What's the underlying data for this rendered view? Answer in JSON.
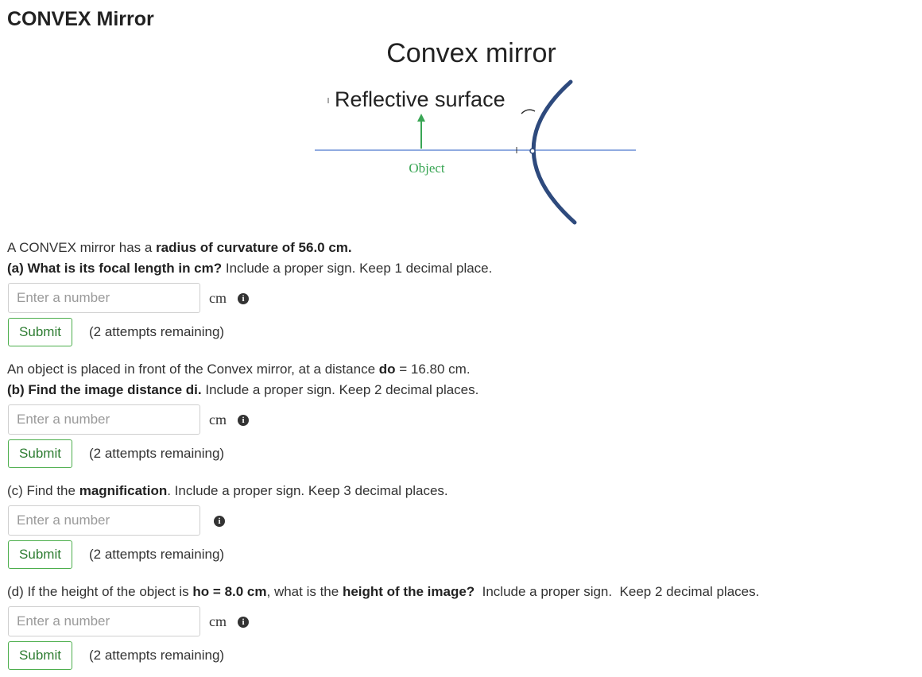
{
  "page_title": "CONVEX Mirror",
  "figure": {
    "title": "Convex mirror",
    "surface_label": "Reflective surface",
    "object_label": "Object",
    "colors": {
      "axis": "#6b8fd6",
      "mirror": "#2e4a7d",
      "object": "#3aa655"
    }
  },
  "intro": {
    "prefix": "A CONVEX mirror has a ",
    "bold": "radius of curvature of 56.0 cm."
  },
  "parts": {
    "a": {
      "bold": "(a) What is its focal length in cm?",
      "text": " Include a proper sign. Keep 1 decimal place.",
      "placeholder": "Enter a number",
      "unit": "cm",
      "submit": "Submit",
      "attempts": "(2 attempts remaining)"
    },
    "b": {
      "context_prefix": "An object is placed in front of the Convex mirror, at a distance ",
      "context_bold": "do",
      "context_suffix": " = 16.80 cm.",
      "bold": "(b) Find the image distance di.",
      "text": " Include a proper sign. Keep 2 decimal places.",
      "placeholder": "Enter a number",
      "unit": "cm",
      "submit": "Submit",
      "attempts": "(2 attempts remaining)"
    },
    "c": {
      "prefix": "(c) Find the ",
      "bold": "magnification",
      "suffix": ". Include a proper sign. Keep 3 decimal places.",
      "placeholder": "Enter a number",
      "submit": "Submit",
      "attempts": "(2 attempts remaining)"
    },
    "d": {
      "prefix": "(d) If the height of the object is ",
      "bold1": "ho = 8.0 cm",
      "middle": ", what is the ",
      "bold2": "height of the image?",
      "suffix": "  Include a proper sign.  Keep 2 decimal places.",
      "placeholder": "Enter a number",
      "unit": "cm",
      "submit": "Submit",
      "attempts": "(2 attempts remaining)"
    }
  },
  "icons": {
    "info": "info-circle-icon"
  }
}
